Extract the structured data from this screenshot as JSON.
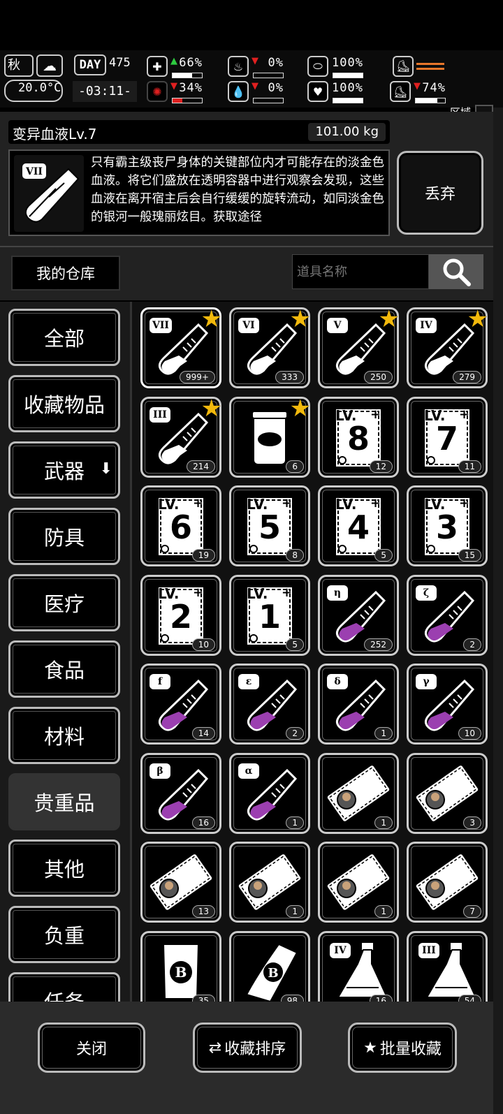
{
  "status": {
    "season": "秋",
    "day_label": "DAY",
    "day": "475",
    "temperature": "20.0°C",
    "time": "-03:11-",
    "stats": [
      {
        "name": "health",
        "icon": "medkit-icon",
        "glyph": "✚",
        "trend": "up",
        "value": "66%",
        "level": 0.66,
        "color": "#ffffff"
      },
      {
        "name": "hunger",
        "icon": "stomach-icon",
        "glyph": "♨",
        "trend": "down",
        "value": "0%",
        "level": 0.0,
        "color": "#ffffff"
      },
      {
        "name": "stamina",
        "icon": "capsule-icon",
        "glyph": "⬭",
        "trend": "",
        "value": "100%",
        "level": 1.0,
        "color": "#ffffff"
      },
      {
        "name": "infection",
        "icon": "virus-icon",
        "glyph": "✺",
        "trend": "down",
        "value": "34%",
        "level": 0.34,
        "color": "#e02020"
      },
      {
        "name": "thirst",
        "icon": "droplet-icon",
        "glyph": "💧",
        "trend": "down",
        "value": "0%",
        "level": 0.0,
        "color": "#ffffff"
      },
      {
        "name": "mood",
        "icon": "heart-icon",
        "glyph": "♥",
        "trend": "",
        "value": "100%",
        "level": 1.0,
        "color": "#ffffff"
      },
      {
        "name": "fatigue",
        "icon": "boot-icon",
        "glyph": "⛸",
        "trend": "down",
        "value": "74%",
        "level": 0.74,
        "color": "#ffffff"
      }
    ],
    "area_heat_label": "区域热度"
  },
  "item": {
    "name": "变异血液Lv.7",
    "weight": "101.00 kg",
    "tier": "VII",
    "description": "只有霸主级丧尸身体的关键部位内才可能存在的淡金色血液。将它们盛放在透明容器中进行观察会发现，这些血液在离开宿主后会自行缓缓的旋转流动，如同淡金色的银河一般瑰丽炫目。获取途径",
    "discard_label": "丢弃"
  },
  "search": {
    "warehouse_label": "我的仓库",
    "placeholder": "道具名称"
  },
  "categories": [
    {
      "label": "全部"
    },
    {
      "label": "收藏物品"
    },
    {
      "label": "武器",
      "has_dropdown": true
    },
    {
      "label": "防具"
    },
    {
      "label": "医疗"
    },
    {
      "label": "食品"
    },
    {
      "label": "材料"
    },
    {
      "label": "贵重品",
      "selected": true
    },
    {
      "label": "其他"
    },
    {
      "label": "负重"
    },
    {
      "label": "任务"
    }
  ],
  "items": [
    {
      "kind": "vial",
      "tag": "VII",
      "fill": "white",
      "count": "999+",
      "star": true
    },
    {
      "kind": "vial",
      "tag": "VI",
      "fill": "white",
      "count": "333",
      "star": true
    },
    {
      "kind": "vial",
      "tag": "V",
      "fill": "white",
      "count": "250",
      "star": true
    },
    {
      "kind": "vial",
      "tag": "IV",
      "fill": "white",
      "count": "279",
      "star": true
    },
    {
      "kind": "vial",
      "tag": "III",
      "fill": "white",
      "count": "214",
      "star": true
    },
    {
      "kind": "bag",
      "tag": "",
      "count": "6",
      "star": true
    },
    {
      "kind": "ticket",
      "tag": "LV.",
      "level": "8",
      "count": "12"
    },
    {
      "kind": "ticket",
      "tag": "LV.",
      "level": "7",
      "count": "11"
    },
    {
      "kind": "ticket",
      "tag": "LV.",
      "level": "6",
      "count": "19"
    },
    {
      "kind": "ticket",
      "tag": "LV.",
      "level": "5",
      "count": "8"
    },
    {
      "kind": "ticket",
      "tag": "LV.",
      "level": "4",
      "count": "5"
    },
    {
      "kind": "ticket",
      "tag": "LV.",
      "level": "3",
      "count": "15"
    },
    {
      "kind": "ticket",
      "tag": "LV.",
      "level": "2",
      "count": "10"
    },
    {
      "kind": "ticket",
      "tag": "LV.",
      "level": "1",
      "count": "5"
    },
    {
      "kind": "vial",
      "tag": "η",
      "fill": "purple",
      "count": "252"
    },
    {
      "kind": "vial",
      "tag": "ζ",
      "fill": "purple",
      "count": "2"
    },
    {
      "kind": "vial",
      "tag": "f",
      "fill": "purple",
      "count": "14"
    },
    {
      "kind": "vial",
      "tag": "ε",
      "fill": "purple",
      "count": "2"
    },
    {
      "kind": "vial",
      "tag": "δ",
      "fill": "purple",
      "count": "1"
    },
    {
      "kind": "vial",
      "tag": "γ",
      "fill": "purple",
      "count": "10"
    },
    {
      "kind": "vial",
      "tag": "β",
      "fill": "purple",
      "count": "16"
    },
    {
      "kind": "vial",
      "tag": "α",
      "fill": "purple",
      "count": "1"
    },
    {
      "kind": "card",
      "tag": "",
      "count": "1"
    },
    {
      "kind": "card",
      "tag": "",
      "count": "3"
    },
    {
      "kind": "card",
      "tag": "",
      "count": "13"
    },
    {
      "kind": "card",
      "tag": "",
      "count": "1"
    },
    {
      "kind": "card",
      "tag": "",
      "count": "1"
    },
    {
      "kind": "card",
      "tag": "",
      "count": "7"
    },
    {
      "kind": "bcoin",
      "tag": "B",
      "count": "35"
    },
    {
      "kind": "scroll",
      "tag": "B",
      "count": "98"
    },
    {
      "kind": "flask",
      "tag": "IV",
      "count": "16"
    },
    {
      "kind": "flask",
      "tag": "III",
      "count": "54"
    }
  ],
  "footer": {
    "close_label": "关闭",
    "sort_label": "收藏排序",
    "batch_label": "批量收藏"
  }
}
